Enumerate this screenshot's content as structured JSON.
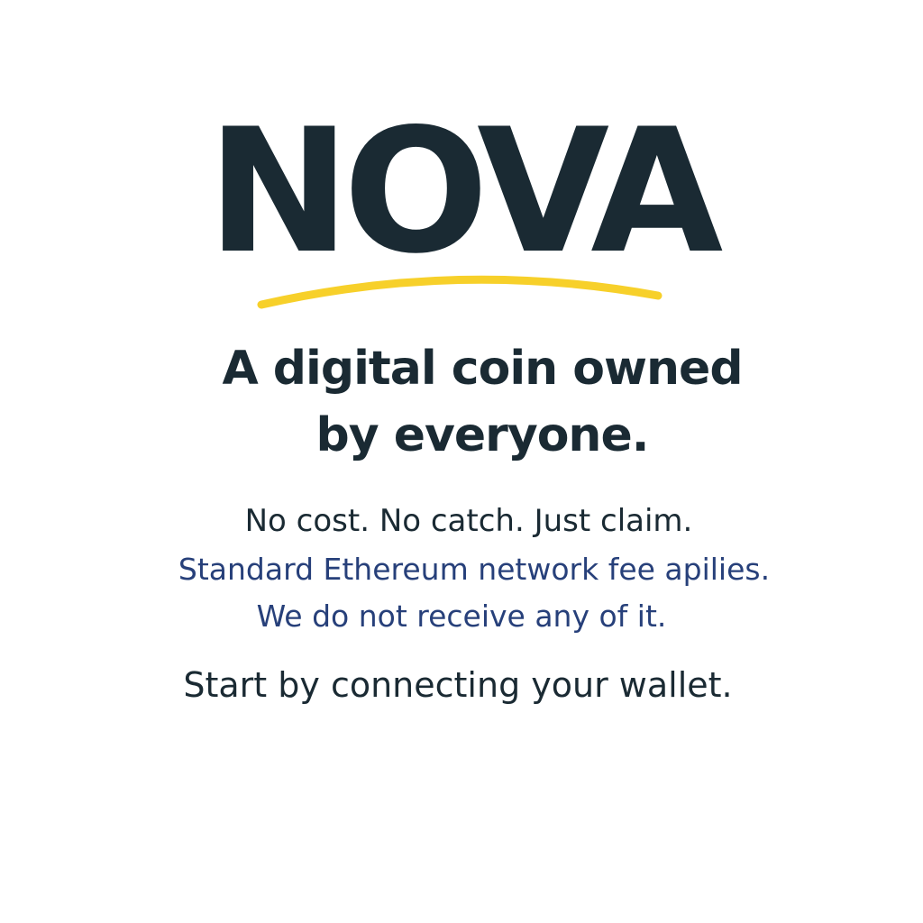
{
  "brand": {
    "name": "NOVA",
    "text_color": "#1a2a33",
    "accent_color": "#f7d02a"
  },
  "headline": {
    "line1": "A digital coin owned",
    "line2": "by everyone."
  },
  "tagline": "No cost. No catch. Just claim.",
  "fee_note": {
    "line1": "Standard Ethereum network fee apilies.",
    "line2": "We do not receive any of it.",
    "color": "#27407a"
  },
  "cta_text": "Start by connecting your wallet."
}
